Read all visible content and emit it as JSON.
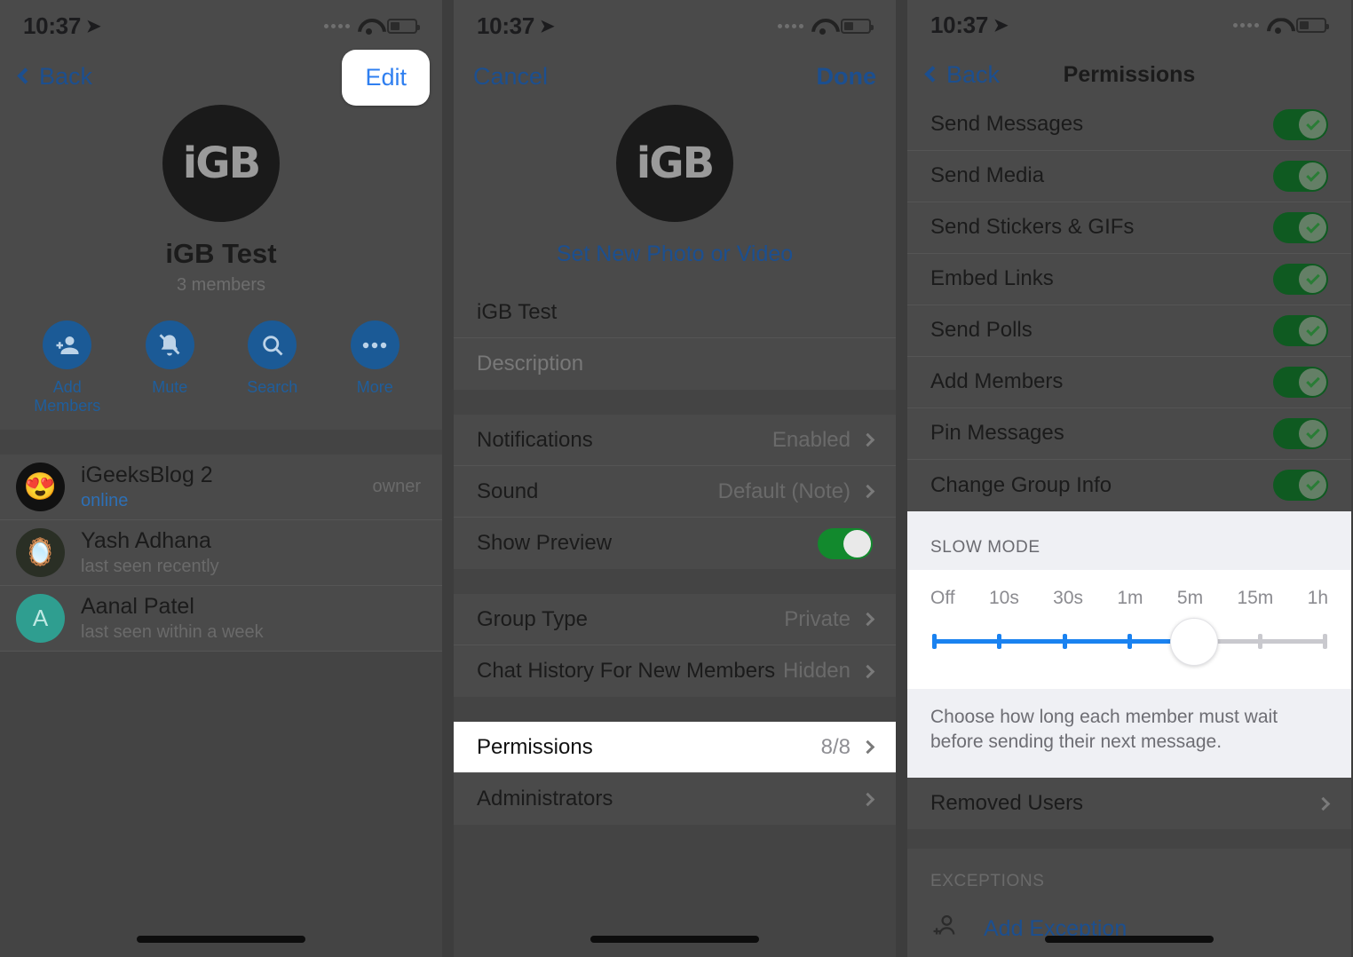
{
  "status_bar": {
    "time": "10:37",
    "location_icon": "location-arrow-icon",
    "wifi_icon": "wifi-icon",
    "battery_icon": "battery-icon"
  },
  "panel1": {
    "nav": {
      "back_label": "Back",
      "edit_label": "Edit"
    },
    "group": {
      "avatar_text": "iGB",
      "name": "iGB Test",
      "members_count": "3 members"
    },
    "actions": [
      {
        "label": "Add Members",
        "icon": "add-member-icon"
      },
      {
        "label": "Mute",
        "icon": "bell-slash-icon"
      },
      {
        "label": "Search",
        "icon": "search-icon"
      },
      {
        "label": "More",
        "icon": "ellipsis-icon"
      }
    ],
    "members": [
      {
        "name": "iGeeksBlog 2",
        "status": "online",
        "online": true,
        "badge": "owner",
        "avatar_kind": "photo"
      },
      {
        "name": "Yash Adhana",
        "status": "last seen recently",
        "online": false,
        "badge": "",
        "avatar_kind": "photo"
      },
      {
        "name": "Aanal Patel",
        "status": "last seen within a week",
        "online": false,
        "badge": "",
        "avatar_kind": "letter",
        "avatar_letter": "A"
      }
    ]
  },
  "panel2": {
    "nav": {
      "cancel_label": "Cancel",
      "done_label": "Done"
    },
    "group": {
      "avatar_text": "iGB",
      "set_photo_label": "Set New Photo or Video"
    },
    "fields": {
      "name_value": "iGB Test",
      "description_placeholder": "Description"
    },
    "notification_rows": [
      {
        "label": "Notifications",
        "value": "Enabled",
        "type": "chevron"
      },
      {
        "label": "Sound",
        "value": "Default (Note)",
        "type": "chevron"
      },
      {
        "label": "Show Preview",
        "value": "on",
        "type": "switch"
      }
    ],
    "group_rows": [
      {
        "label": "Group Type",
        "value": "Private",
        "type": "chevron"
      },
      {
        "label": "Chat History For New Members",
        "value": "Hidden",
        "type": "chevron"
      }
    ],
    "admin_rows": [
      {
        "label": "Permissions",
        "value": "8/8",
        "type": "chevron",
        "highlighted": true
      },
      {
        "label": "Administrators",
        "value": "",
        "type": "chevron",
        "highlighted": false
      }
    ]
  },
  "panel3": {
    "nav": {
      "back_label": "Back",
      "title": "Permissions"
    },
    "permissions": [
      {
        "label": "Send Messages",
        "on": true
      },
      {
        "label": "Send Media",
        "on": true
      },
      {
        "label": "Send Stickers & GIFs",
        "on": true
      },
      {
        "label": "Embed Links",
        "on": true
      },
      {
        "label": "Send Polls",
        "on": true
      },
      {
        "label": "Add Members",
        "on": true
      },
      {
        "label": "Pin Messages",
        "on": true
      },
      {
        "label": "Change Group Info",
        "on": true
      }
    ],
    "slow_mode": {
      "header": "SLOW MODE",
      "options": [
        "Off",
        "10s",
        "30s",
        "1m",
        "5m",
        "15m",
        "1h"
      ],
      "selected_index": 4,
      "selected_value": "5m",
      "note": "Choose how long each member must wait before sending their next message.",
      "track_active_color": "#1a82f0",
      "track_inactive_color": "#c9c9ce"
    },
    "removed_users": {
      "label": "Removed Users"
    },
    "exceptions": {
      "caption": "EXCEPTIONS",
      "add_label": "Add Exception",
      "icon": "add-person-icon"
    }
  },
  "colors": {
    "accent_blue": "#2f7ff0",
    "link_blue": "#1c4f8f",
    "switch_green": "#12892d"
  }
}
